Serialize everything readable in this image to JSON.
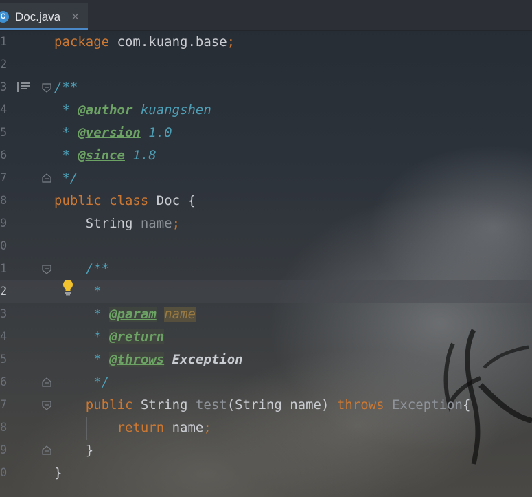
{
  "tab": {
    "icon_letter": "C",
    "filename": "Doc.java",
    "close": "×"
  },
  "line_numbers": [
    "1",
    "2",
    "3",
    "4",
    "5",
    "6",
    "7",
    "8",
    "9",
    "0",
    "1",
    "2",
    "3",
    "4",
    "5",
    "6",
    "7",
    "8",
    "9",
    "0"
  ],
  "active_line_number": "2",
  "code": {
    "l1": {
      "kw": "package",
      "rest": " com.kuang.base",
      "semi": ";"
    },
    "l3": {
      "open": "/**"
    },
    "l4": {
      "star": " * ",
      "tag": "@author",
      "val": " kuangshen"
    },
    "l5": {
      "star": " * ",
      "tag": "@version",
      "val": " 1.0"
    },
    "l6": {
      "star": " * ",
      "tag": "@since",
      "val": " 1.8"
    },
    "l7": {
      "close": " */"
    },
    "l8": {
      "kw1": "public",
      "kw2": "class",
      "name": "Doc",
      "brace": "{"
    },
    "l9": {
      "type": "String",
      "field": "name",
      "semi": ";"
    },
    "l11": {
      "open": "/**"
    },
    "l12": {
      "star": "*"
    },
    "l13": {
      "star": "* ",
      "tag": "@param",
      "val": "name"
    },
    "l14": {
      "star": "* ",
      "tag": "@return"
    },
    "l15": {
      "star": "* ",
      "tag": "@throws",
      "val": "Exception"
    },
    "l16": {
      "close": "*/"
    },
    "l17": {
      "kw1": "public",
      "type": "String",
      "method": "test",
      "params": "(String name)",
      "kw2": "throws",
      "exc": "Exception",
      "brace": "{"
    },
    "l18": {
      "kw": "return",
      "val": " name",
      "semi": ";"
    },
    "l19": {
      "brace": "}"
    },
    "l20": {
      "brace": "}"
    }
  },
  "icons": {
    "file": "java-class-icon",
    "bulb": "intention-bulb-icon",
    "structure": "structure-icon",
    "fold": "fold-marker-icon"
  },
  "colors": {
    "keyword": "#cc7832",
    "doc": "#4e9fb6",
    "doctag": "#6ca364",
    "text": "#c9ccd1",
    "tab_underline": "#4a88c7"
  }
}
